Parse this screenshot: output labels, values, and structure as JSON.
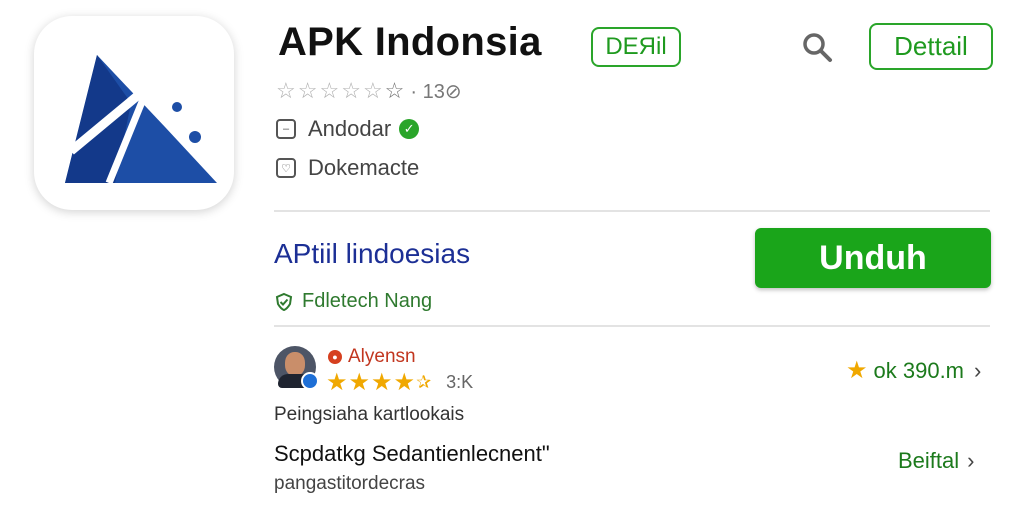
{
  "app": {
    "title": "APK Indonsia",
    "badge": "DEЯil",
    "detail_button": "Dettail",
    "rating_count": "· 13⊘",
    "developer": "Andodar",
    "category": "Dokemacte",
    "icon_name": "app-logo-icon"
  },
  "install": {
    "subtitle": "APtiil lindoesias",
    "button_label": "Unduh",
    "tag": "Fdletech Nang"
  },
  "review": {
    "reviewer": "Alyensn",
    "score": "3:K",
    "stat": "ok 390.m",
    "text": "Peingsiaha kartlookais"
  },
  "section": {
    "title": "Scpdatkg Sedantienlecnent\"",
    "link": "Beiftal",
    "subtitle": "pangastitordecras"
  },
  "colors": {
    "accent_green": "#1aa51a",
    "title_blue": "#1c2f95",
    "star_gold": "#f0a800"
  }
}
